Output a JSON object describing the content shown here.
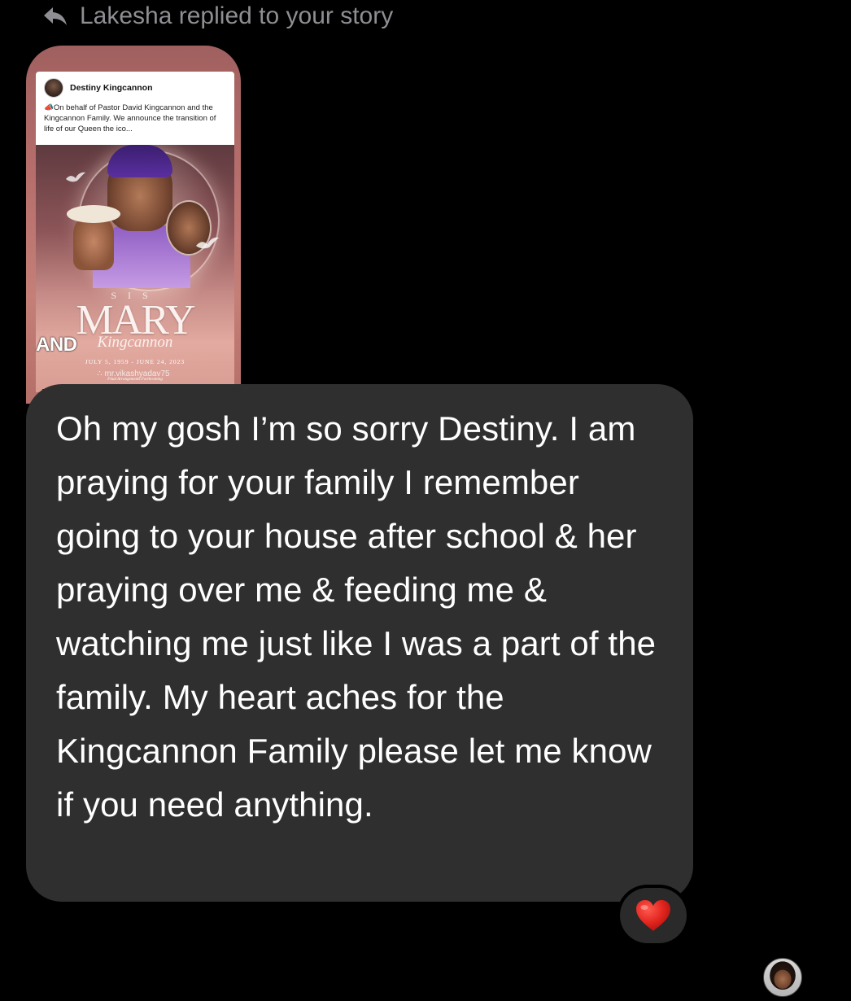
{
  "reply_header": {
    "text": "Lakesha replied to your story",
    "icon": "reply-arrow-icon"
  },
  "story": {
    "post": {
      "author": "Destiny Kingcannon",
      "caption": "On behalf of Pastor David Kingcannon and the Kingcannon Family. We announce the transition of life of our Queen the ico..."
    },
    "memorial": {
      "sis": "SIS",
      "name": "MARY",
      "surname": "Kingcannon",
      "dates": "JULY 5, 1959 - JUNE 24, 2023",
      "footer": "Final Arrangements Forthcoming"
    },
    "overlay_text": "AND",
    "watermark": "∴ mr.vikashyadav75"
  },
  "message": {
    "text": "Oh my gosh I’m so sorry Destiny. I am praying for your family I remember going to your house after school & her praying over me & feeding me & watching me just like I was a part of the family. My heart aches for the Kingcannon Family please let me know if you need anything.",
    "bubble_color": "#2f2f2f"
  },
  "reaction": {
    "emoji": "heart-icon",
    "color": "#e0241e"
  },
  "seen_avatar": {
    "icon": "avatar"
  }
}
